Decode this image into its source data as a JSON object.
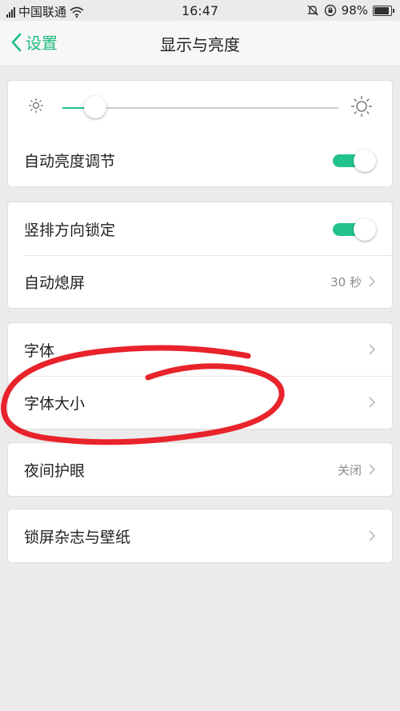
{
  "status_bar": {
    "carrier": "中国联通",
    "time": "16:47",
    "battery": "98%",
    "battery_level": 0.98
  },
  "nav": {
    "back_label": "设置",
    "title": "显示与亮度"
  },
  "brightness": {
    "level": 0.12,
    "auto_label": "自动亮度调节",
    "auto_enabled": true
  },
  "group2": {
    "rotation_lock_label": "竖排方向锁定",
    "rotation_lock_enabled": true,
    "auto_sleep_label": "自动熄屏",
    "auto_sleep_value": "30 秒"
  },
  "group3": {
    "font_label": "字体",
    "font_size_label": "字体大小"
  },
  "group4": {
    "night_label": "夜间护眼",
    "night_value": "关闭"
  },
  "group5": {
    "lock_label": "锁屏杂志与壁纸"
  },
  "colors": {
    "accent": "#22c38a",
    "annotation": "#e8232b"
  }
}
